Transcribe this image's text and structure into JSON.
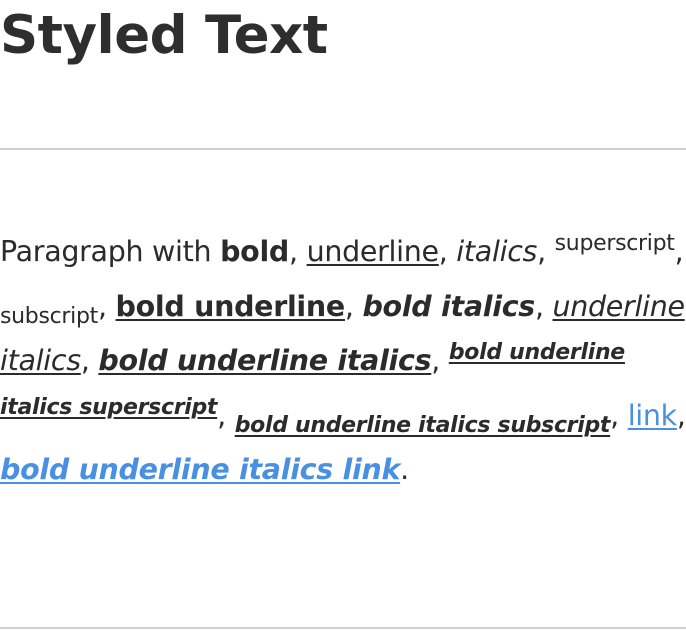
{
  "title": "Styled Text",
  "paragraph": {
    "intro": "Paragraph with ",
    "bold": "bold",
    "sep": ", ",
    "underline": "underline",
    "italics": "italics",
    "superscript": "superscript",
    "subscript": "subscript",
    "bold_underline": "bold underline",
    "bold_italics": "bold italics",
    "underline_italics": "underline italics",
    "bold_underline_italics": "bold underline italics",
    "bold_underline_italics_superscript": "bold underline italics superscript",
    "bold_underline_italics_subscript": "bold underline italics subscript",
    "link": "link",
    "bold_underline_italics_link": "bold underline italics link",
    "end": "."
  },
  "colors": {
    "link": "#4a90e2",
    "text": "#2b2b2b",
    "rule": "#cfcfcf"
  }
}
